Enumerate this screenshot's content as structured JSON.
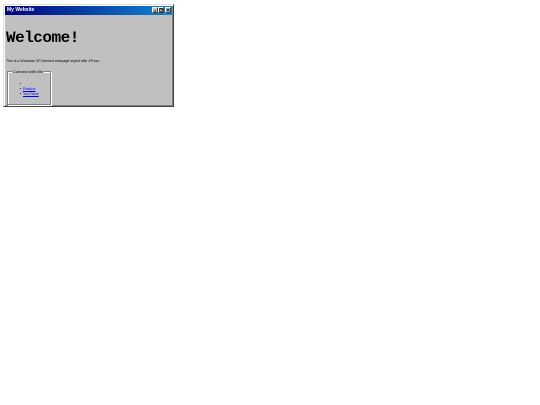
{
  "window": {
    "title": "My Website",
    "controls": {
      "minimize_icon": "minimize-icon",
      "maximize_icon": "maximize-icon",
      "close_icon": "close-icon"
    }
  },
  "page": {
    "heading": "Welcome!",
    "description": "This is a Windows XP-themed webpage styled with XP.css."
  },
  "connect": {
    "legend": "Connect with Me",
    "links": [
      {
        "label": ""
      },
      {
        "label": "Roblox"
      },
      {
        "label": "YouTube"
      }
    ]
  },
  "colors": {
    "titlebar_start": "#000080",
    "titlebar_end": "#1084d0",
    "window_bg": "#c0c0c0",
    "link": "#0000ee"
  }
}
